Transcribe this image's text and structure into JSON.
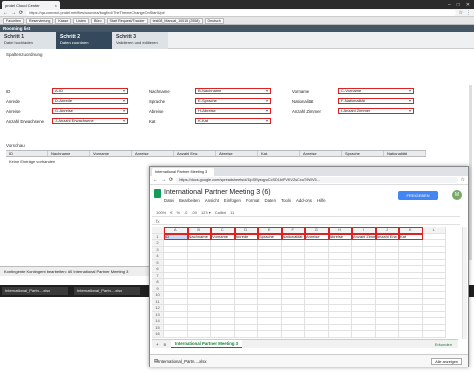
{
  "win1": {
    "tab_title": "protel Cloud Center",
    "url": "https://qa-connect.protel.net/files/sourcea/bugfix4/TheThemeChangeOnStartUp#",
    "nav_buttons": [
      "Favoriten",
      "Reservierung",
      "Kasse",
      "Listen",
      "Büro",
      "Start Request/Tracker",
      "test08_Manual_10015 (2558)",
      "Deutsch"
    ],
    "title": "Rooming list",
    "steps": [
      {
        "num": "Schritt 1",
        "label": "Datei hochladen"
      },
      {
        "num": "Schritt 2",
        "label": "Daten zuordnen"
      },
      {
        "num": "Schritt 3",
        "label": "Validieren und editieren"
      }
    ],
    "section_title": "Spaltenzuordnung",
    "mapping": [
      {
        "label": "ID",
        "value": "A-ID",
        "red": true
      },
      {
        "label": "Anrede",
        "value": "D-Anrede",
        "red": true
      },
      {
        "label": "Anreise",
        "value": "G-Anreise",
        "red": true
      },
      {
        "label": "Anzahl Erwachsene",
        "value": "J-Anzahl Erwachsene",
        "red": true
      },
      {
        "label": "Nachname",
        "value": "B-Nachname",
        "red": true
      },
      {
        "label": "Sprache",
        "value": "E-Sprache",
        "red": true
      },
      {
        "label": "Abreise",
        "value": "H-Abreise",
        "red": true
      },
      {
        "label": "Kat",
        "value": "K-Kat",
        "red": true
      },
      {
        "label": "Vorname",
        "value": "C-Vorname",
        "red": true
      },
      {
        "label": "Nationalität",
        "value": "F-Nationalität",
        "red": true
      },
      {
        "label": "Anzahl Zimmer",
        "value": "I-Anzahl Zimmer",
        "red": true
      }
    ],
    "preview_title": "Vorschau",
    "preview_headers": [
      "ID",
      "Nachname",
      "Vorname",
      "Anreise",
      "Anzahl Erw.",
      "Abreise",
      "Kat.",
      "Anreise",
      "Sprache",
      "Nationalität"
    ],
    "empty_text": "Keine Einträge vorhanden",
    "footer_text": "Kontingente  Kontingent bearbeiten: #0 International Partner Meeting 3"
  },
  "taskbar": [
    "International_Partn....xlsx",
    "International_Partn....xlsx"
  ],
  "win2": {
    "tabs": [
      "International Partner Meeting 3",
      ""
    ],
    "url": "https://docs.google.com/spreadsheets/d/1lpSRyeqyuCcSD1biPVKVZsCxuT9WV5...",
    "doc_title": "International Partner Meeting 3 (6)",
    "menu": [
      "Datei",
      "Bearbeiten",
      "Ansicht",
      "Einfügen",
      "Format",
      "Daten",
      "Tools",
      "Add-ons",
      "Hilfe"
    ],
    "share_label": "FREIGEBEN",
    "avatar_letter": "M",
    "toolbar_items": [
      "100%",
      "€",
      "%",
      ".0",
      ".00",
      "123 ▾",
      "Calibri",
      "11"
    ],
    "fx": "fx",
    "col_headers": [
      "A",
      "B",
      "C",
      "D",
      "E",
      "F",
      "G",
      "H",
      "I",
      "J",
      "K",
      "L"
    ],
    "header_row": [
      "ID",
      "Nachname",
      "Vorname",
      "Anrede",
      "Sprache",
      "Nationalität",
      "Anreise",
      "Abreise",
      "Anzahl Zimmer",
      "Anzahl Erw.",
      "Kat",
      ""
    ],
    "row_numbers": [
      "1",
      "2",
      "3",
      "4",
      "5",
      "6",
      "7",
      "8",
      "9",
      "10",
      "11",
      "12",
      "13",
      "14",
      "15",
      "16"
    ],
    "sheet_tab": "International Partner Meeting 3",
    "explore_label": "Erkunden",
    "download_file": "International_Partn....xlsx",
    "download_btn": "Alle anzeigen"
  }
}
